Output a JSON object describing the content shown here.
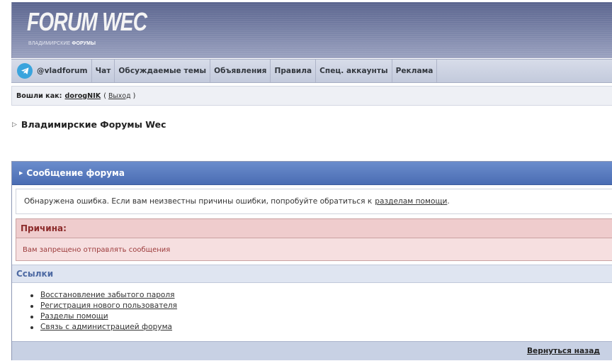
{
  "header": {
    "logo_title": "FORUM WEC",
    "logo_sub_normal": "ВЛАДИМИРСКИЕ ",
    "logo_sub_bold": "ФОРУМЫ"
  },
  "nav": {
    "items": [
      {
        "label": "@vladforum",
        "icon": "telegram-icon"
      },
      {
        "label": "Чат"
      },
      {
        "label": "Обсуждаемые темы"
      },
      {
        "label": "Объявления"
      },
      {
        "label": "Правила"
      },
      {
        "label": "Спец. аккаунты"
      },
      {
        "label": "Реклама"
      }
    ]
  },
  "login": {
    "label": "Вошли как:",
    "username": "dorogNIK",
    "paren_open": "(",
    "logout": "Выход",
    "paren_close": ")"
  },
  "breadcrumb": {
    "title": "Владимирские Форумы Wec"
  },
  "message": {
    "title": "Сообщение форума",
    "info_text": "Обнаружена ошибка. Если вам неизвестны причины ошибки, попробуйте обратиться к",
    "info_link": "разделам помощи",
    "info_end": ".",
    "reason_title": "Причина:",
    "reason_text": "Вам запрещено отправлять сообщения",
    "links_title": "Ссылки",
    "links": [
      "Восстановление забытого пароля",
      "Регистрация нового пользователя",
      "Разделы помощи",
      "Связь с администрацией форума"
    ],
    "back_link": "Вернуться назад"
  },
  "colors": {
    "header_bg": "#6f7aa3",
    "message_header": "#5a7cc0",
    "reason_bg": "#f6dfe0",
    "reason_text": "#8c2b2b",
    "links_title": "#4e6aa3",
    "telegram": "#3aa4dd"
  }
}
